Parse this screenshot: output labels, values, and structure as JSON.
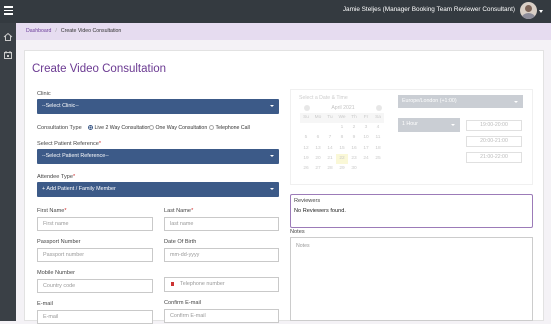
{
  "header": {
    "user": "Jamie Steljes (Manager Booking Team Reviewer Consultant)"
  },
  "breadcrumb": {
    "home": "Dashboard",
    "current": "Create Video Consultation"
  },
  "page_title": "Create Video Consultation",
  "form": {
    "clinic_label": "Clinic",
    "clinic_value": "--Select Clinic--",
    "type_label": "Consultation Type",
    "type_options": [
      "Live 2 Way Consultation",
      "One Way Consultation",
      "Telephone Call"
    ],
    "patient_ref_label": "Select Patient Reference",
    "patient_ref_value": "--Select Patient Reference--",
    "attendee_label": "Attendee Type",
    "attendee_value": "+ Add Patient / Family Member",
    "first_name_label": "First Name",
    "first_name_placeholder": "First name",
    "last_name_label": "Last Name",
    "last_name_placeholder": "last name",
    "passport_label": "Passport Number",
    "passport_placeholder": "Passport number",
    "dob_label": "Date Of Birth",
    "dob_placeholder": "mm-dd-yyyy",
    "mobile_label": "Mobile Number",
    "mobile_placeholder": "Country code",
    "telephone_placeholder": "Telephone number",
    "email_label": "E-mail",
    "email_placeholder": "E-mail",
    "confirm_email_label": "Confirm E-mail",
    "confirm_email_placeholder": "Confirm E-mail",
    "required_mark": "*"
  },
  "schedule": {
    "hint": "Select a Date & Time",
    "month": "April 2021",
    "weekdays": [
      "Su",
      "Mo",
      "Tu",
      "We",
      "Th",
      "Fr",
      "Sa"
    ],
    "days": [
      "",
      "",
      "",
      "1",
      "2",
      "3",
      "4",
      "5",
      "6",
      "7",
      "8",
      "9",
      "10",
      "11",
      "12",
      "13",
      "14",
      "15",
      "16",
      "17",
      "18",
      "19",
      "20",
      "21",
      "22",
      "23",
      "24",
      "25",
      "26",
      "27",
      "28",
      "29",
      "30",
      ""
    ],
    "timezone": "Europe/London (+1:00)",
    "duration": "1 Hour",
    "slots": [
      "19:00-20:00",
      "20:00-21:00",
      "21:00-22:00"
    ]
  },
  "reviewers": {
    "label": "Reviewers",
    "empty_text": "No Reviewers found."
  },
  "notes": {
    "label": "Notes",
    "placeholder": "Notes"
  }
}
